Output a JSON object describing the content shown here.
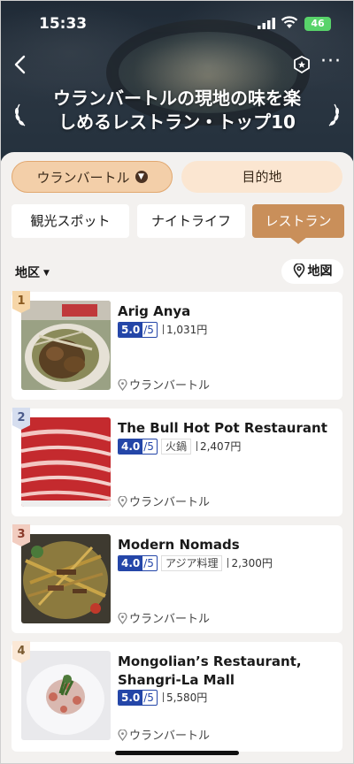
{
  "status_bar": {
    "time": "15:33",
    "battery": "46"
  },
  "header": {
    "title_line1": "ウランバートルの現地の味を楽",
    "title_line2": "しめるレストラン・トップ10",
    "more_label": "···"
  },
  "filters": {
    "city": "ウランバートル",
    "destination": "目的地"
  },
  "categories": [
    {
      "label": "観光スポット"
    },
    {
      "label": "ナイトライフ"
    },
    {
      "label": "レストラン"
    }
  ],
  "region_label": "地区",
  "map_label": "地図",
  "restaurants": [
    {
      "rank": "1",
      "name": "Arig Anya",
      "score": "5.0",
      "max": "/5",
      "tag": "",
      "price": "1,031円",
      "location": "ウランバートル"
    },
    {
      "rank": "2",
      "name": "The Bull Hot Pot Restaurant",
      "score": "4.0",
      "max": "/5",
      "tag": "火鍋",
      "price": "2,407円",
      "location": "ウランバートル"
    },
    {
      "rank": "3",
      "name": "Modern Nomads",
      "score": "4.0",
      "max": "/5",
      "tag": "アジア料理",
      "price": "2,300円",
      "location": "ウランバートル"
    },
    {
      "rank": "4",
      "name": "Mongolian’s Restaurant, Shangri-La Mall",
      "score": "5.0",
      "max": "/5",
      "tag": "",
      "price": "5,580円",
      "location": "ウランバートル"
    }
  ],
  "colors": {
    "accent": "#c98f5a",
    "score_blue": "#2446a8",
    "city_chip": "#f3cfa9",
    "dest_chip": "#fbe6d1"
  }
}
